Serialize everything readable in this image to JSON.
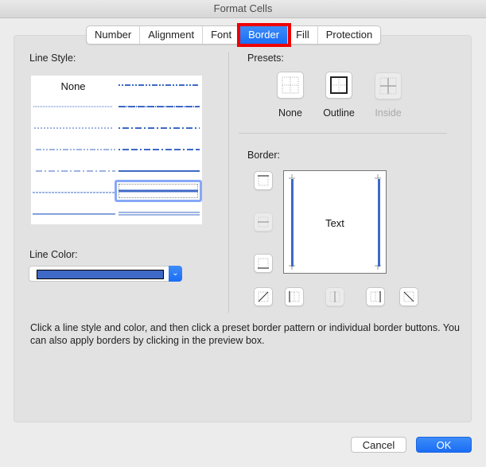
{
  "window": {
    "title": "Format Cells"
  },
  "tabs": [
    {
      "label": "Number",
      "active": false
    },
    {
      "label": "Alignment",
      "active": false
    },
    {
      "label": "Font",
      "active": false
    },
    {
      "label": "Border",
      "active": true
    },
    {
      "label": "Fill",
      "active": false
    },
    {
      "label": "Protection",
      "active": false
    }
  ],
  "line_style": {
    "label": "Line Style:",
    "none_label": "None",
    "selected": "medium-solid",
    "styles_left": [
      "none",
      "hair",
      "dotted",
      "dash-dot-dot",
      "dash-dot",
      "dashed",
      "thin"
    ],
    "styles_right": [
      "medium-dash-dot-dot",
      "slanted-dash-dot",
      "medium-dash-dot",
      "medium-dashed",
      "medium",
      "medium-solid",
      "double"
    ]
  },
  "line_color": {
    "label": "Line Color:",
    "value": "#3e69c6",
    "arrow_icon": "chevron-down-icon"
  },
  "presets": {
    "label": "Presets:",
    "items": [
      {
        "label": "None",
        "icon": "preset-none-icon",
        "enabled": true
      },
      {
        "label": "Outline",
        "icon": "preset-outline-icon",
        "enabled": true
      },
      {
        "label": "Inside",
        "icon": "preset-inside-icon",
        "enabled": false
      }
    ]
  },
  "border": {
    "label": "Border:",
    "preview_text": "Text",
    "buttons": [
      {
        "name": "top-border",
        "enabled": true
      },
      {
        "name": "middle-horizontal-border",
        "enabled": false
      },
      {
        "name": "bottom-border",
        "enabled": true
      },
      {
        "name": "diagonal-up-border",
        "enabled": true
      },
      {
        "name": "left-border",
        "enabled": true
      },
      {
        "name": "middle-vertical-border",
        "enabled": false
      },
      {
        "name": "right-border",
        "enabled": true
      },
      {
        "name": "diagonal-down-border",
        "enabled": true
      }
    ],
    "applied": [
      "left",
      "right"
    ]
  },
  "help_text": "Click a line style and color, and then click a preset border pattern or individual border buttons. You can also apply borders by clicking in the preview box.",
  "footer": {
    "cancel_label": "Cancel",
    "ok_label": "OK"
  },
  "colors": {
    "accent": "#1a6df5",
    "line": "#3e69c6",
    "highlight_outline": "#ee0000"
  }
}
